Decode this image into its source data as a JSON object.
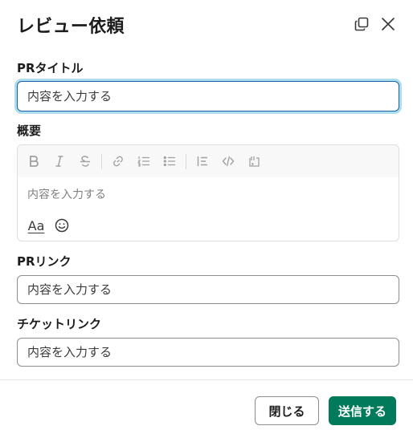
{
  "modal": {
    "title": "レビュー依頼"
  },
  "fields": {
    "pr_title": {
      "label": "PRタイトル",
      "placeholder": "内容を入力する"
    },
    "summary": {
      "label": "概要",
      "placeholder": "内容を入力する",
      "text_style_button": "Aa"
    },
    "pr_link": {
      "label": "PRリンク",
      "placeholder": "内容を入力する"
    },
    "ticket_link": {
      "label": "チケットリンク",
      "placeholder": "内容を入力する"
    }
  },
  "footer": {
    "cancel_label": "閉じる",
    "submit_label": "送信する"
  },
  "colors": {
    "primary": "#007a5a",
    "focus": "#1264a3",
    "text": "#1d1c1d"
  }
}
